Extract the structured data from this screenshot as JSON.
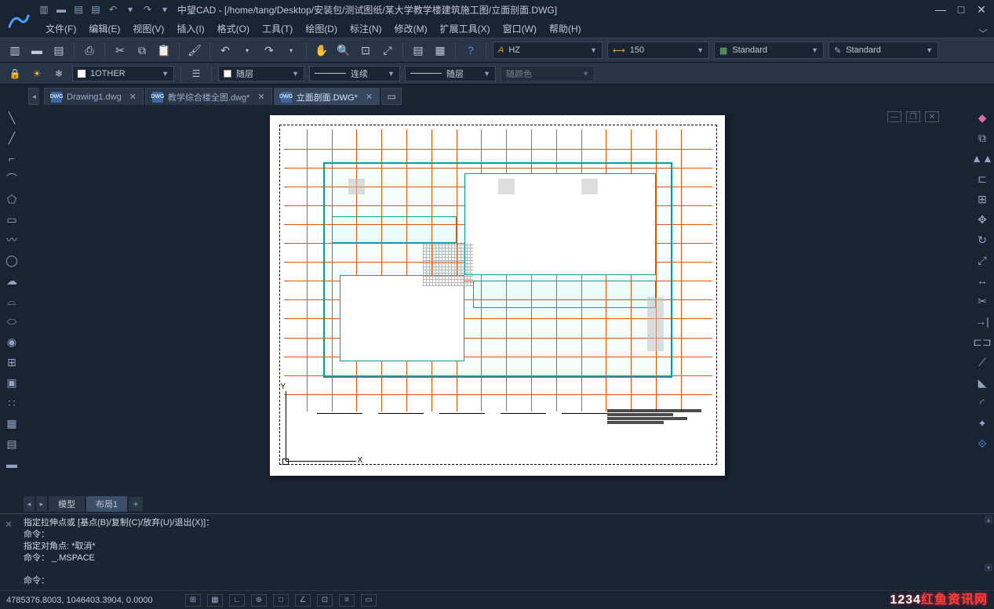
{
  "titlebar": {
    "appname": "中望CAD",
    "path": "[/home/tang/Desktop/安装包/测试图纸/某大学教学楼建筑施工图/立面剖面.DWG]"
  },
  "menubar": {
    "items": [
      {
        "label": "文件(F)"
      },
      {
        "label": "编辑(E)"
      },
      {
        "label": "视图(V)"
      },
      {
        "label": "插入(I)"
      },
      {
        "label": "格式(O)"
      },
      {
        "label": "工具(T)"
      },
      {
        "label": "绘图(D)"
      },
      {
        "label": "标注(N)"
      },
      {
        "label": "修改(M)"
      },
      {
        "label": "扩展工具(X)"
      },
      {
        "label": "窗口(W)"
      },
      {
        "label": "帮助(H)"
      }
    ]
  },
  "ribbon": {
    "textstyle": "HZ",
    "dimstyle": "150",
    "tablestyle": "Standard",
    "other": "Standard"
  },
  "propbar": {
    "layer": "1OTHER",
    "color": "随层",
    "linetype": "连续",
    "lineweight": "随层",
    "plotstyle": "随颜色"
  },
  "tabs": [
    {
      "label": "Drawing1.dwg",
      "active": false
    },
    {
      "label": "教学综合楼全图.dwg*",
      "active": false
    },
    {
      "label": "立面剖面.DWG*",
      "active": true
    }
  ],
  "canvas": {
    "axisX": "X",
    "axisY": "Y"
  },
  "layouttabs": {
    "model": "模型",
    "layout1": "布局1"
  },
  "cmd": {
    "l1": "指定拉伸点或 [基点(B)/复制(C)/放弃(U)/退出(X)]：",
    "l2": "命令：",
    "l3": "指定对角点: *取消*",
    "l4": "命令： _.MSPACE",
    "prompt": "命令："
  },
  "statusbar": {
    "coords": "4785376.8003, 1046403.3904, 0.0000"
  },
  "watermark": {
    "a": "1234",
    "b": "红鱼资讯网"
  }
}
